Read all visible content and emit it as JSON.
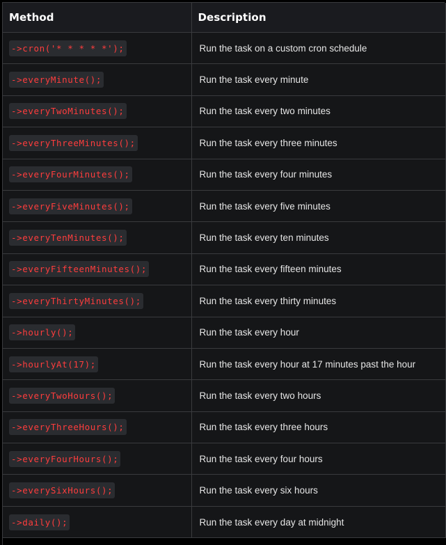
{
  "headers": {
    "method": "Method",
    "description": "Description"
  },
  "rows": [
    {
      "method": "->cron('* * * * *');",
      "description": "Run the task on a custom cron schedule"
    },
    {
      "method": "->everyMinute();",
      "description": "Run the task every minute"
    },
    {
      "method": "->everyTwoMinutes();",
      "description": "Run the task every two minutes"
    },
    {
      "method": "->everyThreeMinutes();",
      "description": "Run the task every three minutes"
    },
    {
      "method": "->everyFourMinutes();",
      "description": "Run the task every four minutes"
    },
    {
      "method": "->everyFiveMinutes();",
      "description": "Run the task every five minutes"
    },
    {
      "method": "->everyTenMinutes();",
      "description": "Run the task every ten minutes"
    },
    {
      "method": "->everyFifteenMinutes();",
      "description": "Run the task every fifteen minutes"
    },
    {
      "method": "->everyThirtyMinutes();",
      "description": "Run the task every thirty minutes"
    },
    {
      "method": "->hourly();",
      "description": "Run the task every hour"
    },
    {
      "method": "->hourlyAt(17);",
      "description": "Run the task every hour at 17 minutes past the hour"
    },
    {
      "method": "->everyTwoHours();",
      "description": "Run the task every two hours"
    },
    {
      "method": "->everyThreeHours();",
      "description": "Run the task every three hours"
    },
    {
      "method": "->everyFourHours();",
      "description": "Run the task every four hours"
    },
    {
      "method": "->everySixHours();",
      "description": "Run the task every six hours"
    },
    {
      "method": "->daily();",
      "description": "Run the task every day at midnight"
    }
  ],
  "colors": {
    "background": "#000000",
    "header_bg": "#1a1b1f",
    "cell_bg": "#151618",
    "border": "#3a3b3e",
    "code_bg": "#2a2c30",
    "code_text": "#ff3d3d",
    "text": "#e6e6e6"
  }
}
